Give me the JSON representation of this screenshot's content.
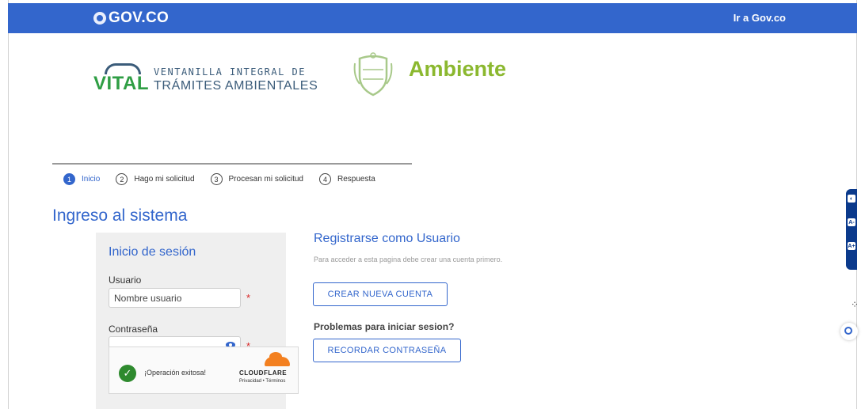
{
  "header": {
    "logo_text": "GOV.CO",
    "link_label": "Ir a Gov.co"
  },
  "brand": {
    "vital_word": "VITAL",
    "vital_line1": "VENTANILLA INTEGRAL DE",
    "vital_line2": "TRÁMITES AMBIENTALES",
    "ministry": "Ambiente"
  },
  "steps": [
    {
      "num": "1",
      "label": "Inicio"
    },
    {
      "num": "2",
      "label": "Hago mi solicitud"
    },
    {
      "num": "3",
      "label": "Procesan mi solicitud"
    },
    {
      "num": "4",
      "label": "Respuesta"
    }
  ],
  "page_title": "Ingreso al sistema",
  "login": {
    "title": "Inicio de sesión",
    "user_label": "Usuario",
    "user_placeholder": "Nombre usuario",
    "password_label": "Contraseña",
    "required_mark": "*",
    "captcha_status": "¡Operación exitosa!",
    "captcha_brand": "CLOUDFLARE",
    "captcha_links": "Privacidad • Términos"
  },
  "register": {
    "title": "Registrarse como Usuario",
    "subtitle": "Para acceder a esta pagina debe crear una cuenta primero.",
    "create_button": "CREAR NUEVA CUENTA",
    "problems_text": "Problemas para iniciar sesion?",
    "recover_button": "RECORDAR CONTRASEÑA"
  },
  "accessibility": {
    "contrast_icon": "contrast-icon",
    "decrease_font_icon": "decrease-font-icon",
    "increase_font_icon": "increase-font-icon",
    "a_minus": "A-",
    "a_plus": "A+"
  },
  "colors": {
    "primary": "#3366cc",
    "vital_green": "#2f9e44",
    "ambiente_green": "#8bb82f",
    "required_red": "#d92525"
  }
}
